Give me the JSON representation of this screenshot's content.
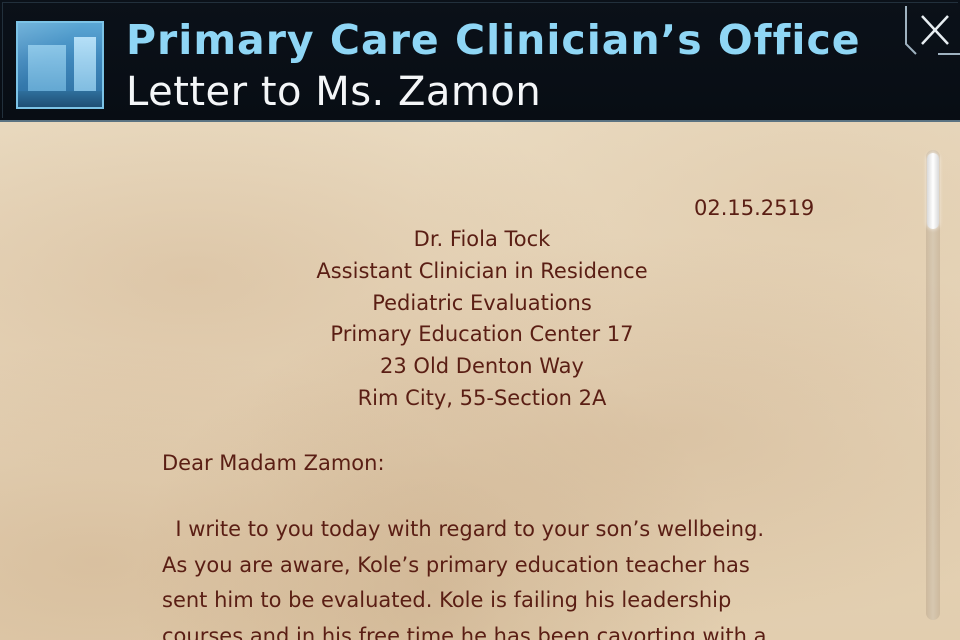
{
  "header": {
    "title": "Primary Care Clinician’s Office",
    "subtitle": "Letter to Ms. Zamon",
    "thumbnail_icon": "room-photo",
    "close_icon": "close-x-icon"
  },
  "letter": {
    "date": "02.15.2519",
    "address_lines": [
      "Dr. Fiola Tock",
      "Assistant Clinician in Residence",
      "Pediatric Evaluations",
      "Primary Education Center 17",
      "23 Old Denton Way",
      "Rim City, 55-Section 2A"
    ],
    "salutation": "Dear Madam Zamon:",
    "body_lines": [
      "  I write to you today with regard to your son’s wellbeing.",
      "As you are aware, Kole’s primary education teacher has",
      "sent him to be evaluated. Kole is failing his leadership",
      "courses and in his free time he has been cavorting with a"
    ]
  },
  "colors": {
    "title": "#8fd6f5",
    "subtitle": "#f4f6f8",
    "letter_text": "#5a1e14",
    "header_bg": "#0a0f18"
  }
}
